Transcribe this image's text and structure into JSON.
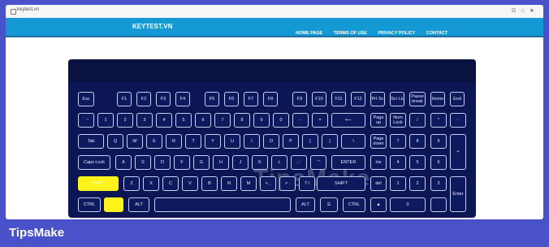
{
  "browser": {
    "url": "keytest.vn",
    "icons": [
      "G",
      "☆",
      "★"
    ]
  },
  "site": {
    "logo": "KEYTEST.VN",
    "nav": [
      "HOME PAGE",
      "TERMS OF USE",
      "PRIVACY POLICY",
      "CONTACT"
    ]
  },
  "keyboard": {
    "keys": [
      {
        "label": "Esc",
        "name": "esc"
      },
      {
        "label": "F1",
        "name": "f1"
      },
      {
        "label": "F2",
        "name": "f2"
      },
      {
        "label": "F3",
        "name": "f3"
      },
      {
        "label": "F4",
        "name": "f4"
      },
      {
        "label": "F5",
        "name": "f5"
      },
      {
        "label": "F6",
        "name": "f6"
      },
      {
        "label": "F7",
        "name": "f7"
      },
      {
        "label": "F8",
        "name": "f8"
      },
      {
        "label": "F9",
        "name": "f9"
      },
      {
        "label": "F10",
        "name": "f10"
      },
      {
        "label": "F11",
        "name": "f11"
      },
      {
        "label": "F12",
        "name": "f12"
      },
      {
        "label": "Prt Sc",
        "name": "print-screen"
      },
      {
        "label": "Scr Lk",
        "name": "scroll-lock"
      },
      {
        "label": "Pause break",
        "name": "pause"
      },
      {
        "label": "Home",
        "name": "home"
      },
      {
        "label": "End",
        "name": "end"
      },
      {
        "label": "` ~",
        "name": "backtick"
      },
      {
        "label": "1",
        "name": "digit-1"
      },
      {
        "label": "2",
        "name": "digit-2"
      },
      {
        "label": "3",
        "name": "digit-3"
      },
      {
        "label": "4",
        "name": "digit-4"
      },
      {
        "label": "5",
        "name": "digit-5"
      },
      {
        "label": "6",
        "name": "digit-6"
      },
      {
        "label": "7",
        "name": "digit-7"
      },
      {
        "label": "8",
        "name": "digit-8"
      },
      {
        "label": "9",
        "name": "digit-9"
      },
      {
        "label": "0",
        "name": "digit-0"
      },
      {
        "label": "-",
        "name": "minus"
      },
      {
        "label": "=",
        "name": "equals"
      },
      {
        "label": "⟵",
        "name": "backspace"
      },
      {
        "label": "Page up",
        "name": "page-up"
      },
      {
        "label": "Num Lock",
        "name": "num-lock"
      },
      {
        "label": "/",
        "name": "num-divide"
      },
      {
        "label": "*",
        "name": "num-multiply"
      },
      {
        "label": "-",
        "name": "num-minus"
      },
      {
        "label": "Tab",
        "name": "tab"
      },
      {
        "label": "Q",
        "name": "q"
      },
      {
        "label": "W",
        "name": "w"
      },
      {
        "label": "E",
        "name": "e"
      },
      {
        "label": "R",
        "name": "r"
      },
      {
        "label": "T",
        "name": "t"
      },
      {
        "label": "Y",
        "name": "y"
      },
      {
        "label": "U",
        "name": "u"
      },
      {
        "label": "I",
        "name": "i"
      },
      {
        "label": "O",
        "name": "o"
      },
      {
        "label": "P",
        "name": "p"
      },
      {
        "label": "[",
        "name": "bracket-left"
      },
      {
        "label": "]",
        "name": "bracket-right"
      },
      {
        "label": "\\",
        "name": "backslash"
      },
      {
        "label": "Page down",
        "name": "page-down"
      },
      {
        "label": "7",
        "name": "num-7"
      },
      {
        "label": "8",
        "name": "num-8"
      },
      {
        "label": "9",
        "name": "num-9"
      },
      {
        "label": "+",
        "name": "num-plus"
      },
      {
        "label": "Caps Lock",
        "name": "caps-lock"
      },
      {
        "label": "A",
        "name": "a"
      },
      {
        "label": "S",
        "name": "s"
      },
      {
        "label": "D",
        "name": "d"
      },
      {
        "label": "F",
        "name": "f"
      },
      {
        "label": "G",
        "name": "g"
      },
      {
        "label": "H",
        "name": "h"
      },
      {
        "label": "J",
        "name": "j"
      },
      {
        "label": "K",
        "name": "k"
      },
      {
        "label": "L",
        "name": "l"
      },
      {
        "label": "; :",
        "name": "semicolon"
      },
      {
        "label": "' \"",
        "name": "quote"
      },
      {
        "label": "ENTER",
        "name": "enter"
      },
      {
        "label": "ins",
        "name": "insert"
      },
      {
        "label": "4",
        "name": "num-4"
      },
      {
        "label": "5",
        "name": "num-5"
      },
      {
        "label": "6",
        "name": "num-6"
      },
      {
        "label": "SHIFT",
        "name": "shift-left"
      },
      {
        "label": "Z",
        "name": "z"
      },
      {
        "label": "X",
        "name": "x"
      },
      {
        "label": "C",
        "name": "c"
      },
      {
        "label": "V",
        "name": "v"
      },
      {
        "label": "B",
        "name": "b"
      },
      {
        "label": "N",
        "name": "n"
      },
      {
        "label": "M",
        "name": "m"
      },
      {
        "label": "< ,",
        "name": "comma"
      },
      {
        "label": "> .",
        "name": "period"
      },
      {
        "label": "? /",
        "name": "slash"
      },
      {
        "label": "SHIFT",
        "name": "shift-right"
      },
      {
        "label": "del",
        "name": "delete"
      },
      {
        "label": "1",
        "name": "num-1"
      },
      {
        "label": "2",
        "name": "num-2"
      },
      {
        "label": "3",
        "name": "num-3"
      },
      {
        "label": "Enter",
        "name": "num-enter"
      },
      {
        "label": "CTRL",
        "name": "ctrl-left"
      },
      {
        "label": "",
        "name": "win"
      },
      {
        "label": "ALT",
        "name": "alt-left"
      },
      {
        "label": "",
        "name": "space"
      },
      {
        "label": "ALT",
        "name": "alt-right"
      },
      {
        "label": "☰",
        "name": "menu"
      },
      {
        "label": "CTRL",
        "name": "ctrl-right"
      },
      {
        "label": "▲",
        "name": "arrow-up"
      },
      {
        "label": "0",
        "name": "num-0"
      },
      {
        "label": ".",
        "name": "num-decimal"
      }
    ],
    "highlighted": [
      "shift-left",
      "win"
    ],
    "watermark": "TipsMake"
  },
  "footer": {
    "brand": "TipsMake"
  }
}
